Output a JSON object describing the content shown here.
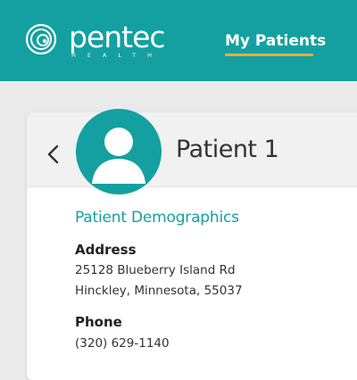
{
  "header": {
    "logo": {
      "wordmark": "pentec",
      "subtext": "HEALTH",
      "icon": "pentec-swirl-logo"
    },
    "nav": {
      "active_tab": "My Patients"
    },
    "colors": {
      "brand": "#14a0a1",
      "accent_underline": "#f2a93b"
    }
  },
  "patient": {
    "back_icon": "chevron-left-icon",
    "avatar_icon": "user-avatar-icon",
    "name": "Patient 1",
    "demographics": {
      "section_title": "Patient Demographics",
      "address_label": "Address",
      "address_line1": "25128 Blueberry Island Rd",
      "address_line2": "Hinckley, Minnesota, 55037",
      "phone_label": "Phone",
      "phone_value": "(320) 629-1140"
    }
  }
}
